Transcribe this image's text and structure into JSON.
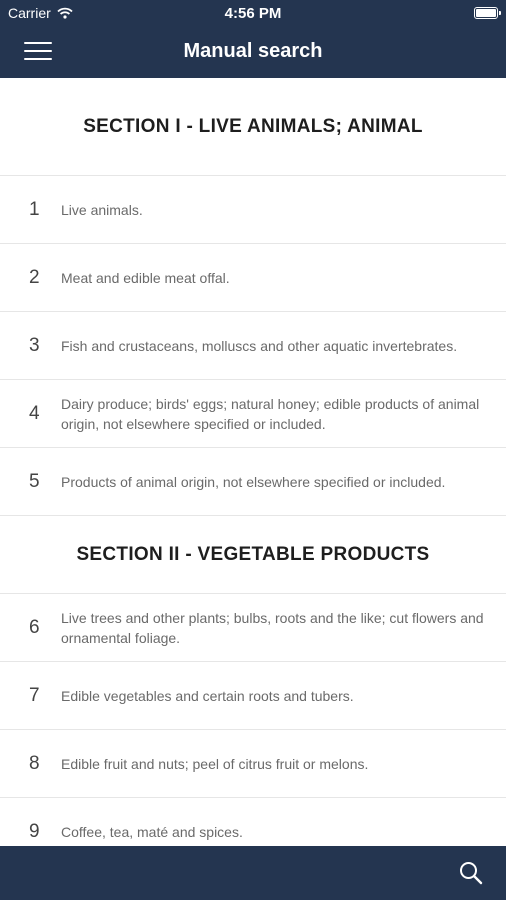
{
  "status_bar": {
    "carrier": "Carrier",
    "time": "4:56 PM"
  },
  "header": {
    "title": "Manual search"
  },
  "sections": [
    {
      "title": "SECTION I - LIVE ANIMALS; ANIMAL",
      "items": [
        {
          "number": "1",
          "text": "Live animals."
        },
        {
          "number": "2",
          "text": "Meat and edible meat offal."
        },
        {
          "number": "3",
          "text": "Fish and crustaceans, molluscs and other aquatic invertebrates."
        },
        {
          "number": "4",
          "text": "Dairy produce; birds' eggs; natural honey; edible products of animal origin, not elsewhere specified or included."
        },
        {
          "number": "5",
          "text": "Products of animal origin, not elsewhere specified or included."
        }
      ]
    },
    {
      "title": "SECTION II - VEGETABLE PRODUCTS",
      "items": [
        {
          "number": "6",
          "text": "Live trees and other plants; bulbs, roots and the like; cut flowers and ornamental foliage."
        },
        {
          "number": "7",
          "text": "Edible vegetables and certain roots and tubers."
        },
        {
          "number": "8",
          "text": "Edible fruit and nuts; peel of citrus fruit or melons."
        },
        {
          "number": "9",
          "text": "Coffee, tea, maté and spices."
        }
      ]
    }
  ],
  "icons": {
    "menu": "hamburger-menu-icon",
    "search": "search-icon",
    "wifi": "wifi-icon",
    "battery": "battery-icon"
  },
  "colors": {
    "header_bg": "#243550",
    "divider": "#e6e6e6",
    "item_text": "#6a6a6a"
  }
}
